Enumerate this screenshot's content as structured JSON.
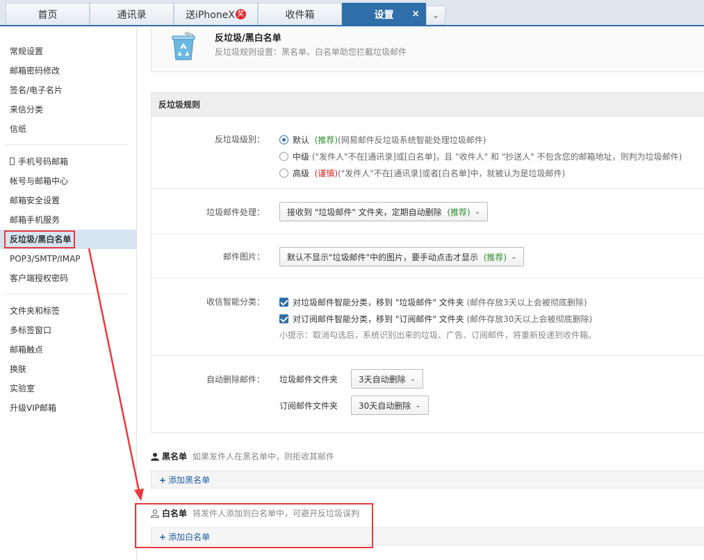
{
  "tabs": [
    {
      "label": "首页"
    },
    {
      "label": "通讯录"
    },
    {
      "label": "送iPhoneX",
      "badge": "奖"
    },
    {
      "label": "收件箱"
    },
    {
      "label": "设置",
      "close": "×"
    }
  ],
  "tab_more": "⌄",
  "sidebar": {
    "group1": [
      "常规设置",
      "邮箱密码修改",
      "签名/电子名片",
      "来信分类",
      "信纸"
    ],
    "group2": [
      "手机号码邮箱",
      "帐号与邮箱中心",
      "邮箱安全设置",
      "邮箱手机服务",
      "反垃圾/黑白名单",
      "POP3/SMTP/IMAP",
      "客户端授权密码"
    ],
    "group3": [
      "文件夹和标签",
      "多标签窗口",
      "邮箱触点",
      "换肤",
      "实验室",
      "升级VIP邮箱"
    ]
  },
  "header": {
    "title": "反垃圾/黑白名单",
    "subtitle": "反垃圾规则设置：黑名单、白名单助您拦截垃圾邮件"
  },
  "rules": {
    "heading": "反垃圾规则",
    "level": {
      "label": "反垃圾级别：",
      "options": [
        {
          "name": "默认",
          "tag": "(推荐)",
          "desc": "(网易邮件反垃圾系统智能处理垃圾邮件)",
          "selected": true
        },
        {
          "name": "中级",
          "tag": "",
          "desc": "(\"发件人\"不在[通讯录]或[白名单]，且 \"收件人\" 和 \"抄送人\" 不包含您的邮箱地址，则判为垃圾邮件)",
          "selected": false
        },
        {
          "name": "高级",
          "tag": "(谨慎)",
          "desc": "(\"发件人\"不在[通讯录]或者[白名单]中，就被认为是垃圾邮件)",
          "selected": false
        }
      ]
    },
    "spam_handling": {
      "label": "垃圾邮件处理：",
      "value": "接收到 \"垃圾邮件\" 文件夹，定期自动删除",
      "tag": "(推荐)"
    },
    "spam_images": {
      "label": "邮件图片：",
      "value": "默认不显示\"垃圾邮件\"中的图片，要手动点击才显示",
      "tag": "(推荐)"
    },
    "smart_classify": {
      "label": "收信智能分类：",
      "options": [
        {
          "text": "对垃圾邮件智能分类，移到 \"垃圾邮件\" 文件夹",
          "note": "(邮件存放3天以上会被彻底删除)",
          "checked": true
        },
        {
          "text": "对订阅邮件智能分类，移到 \"订阅邮件\" 文件夹",
          "note": "(邮件存放30天以上会被彻底删除)",
          "checked": true
        }
      ],
      "tip": "小提示：取消勾选后，系统识别出来的垃圾、广告、订阅邮件，将重新投递到收件箱。"
    },
    "auto_delete": {
      "label": "自动删除邮件：",
      "spam_folder": "垃圾邮件文件夹",
      "spam_value": "3天自动删除",
      "sub_folder": "订阅邮件文件夹",
      "sub_value": "30天自动删除"
    }
  },
  "blacklist": {
    "title": "黑名单",
    "desc": "如果发件人在黑名单中，则拒收其邮件",
    "add": "添加黑名单"
  },
  "whitelist": {
    "title": "白名单",
    "desc": "将发件人添加到白名单中，可避开反垃圾误判",
    "add": "添加白名单"
  },
  "colors": {
    "accent": "#2f6ea8",
    "annotation": "#e8383d",
    "recommend": "#2d8a2d",
    "caution": "#d02020"
  }
}
